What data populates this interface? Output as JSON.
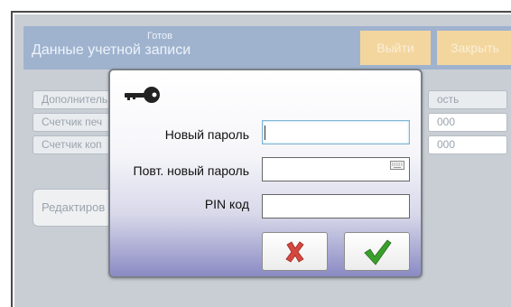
{
  "header": {
    "title": "Данные учетной записи",
    "status": "Готов",
    "logout_label": "Выйти",
    "close_label": "Закрыть"
  },
  "background_fields": [
    "Дополнитель",
    "Счетчик печ",
    "Счетчик коп"
  ],
  "background_values": [
    "ость",
    "000",
    "000"
  ],
  "edit_button": "Редактиров",
  "dialog": {
    "new_password_label": "Новый пароль",
    "new_password_value": "",
    "repeat_password_label": "Повт. новый пароль",
    "repeat_password_value": "",
    "pin_label": "PIN код",
    "pin_value": "",
    "cancel_icon": "red-x-icon",
    "ok_icon": "green-check-icon"
  },
  "colors": {
    "header_bg": "#9fb3cf",
    "header_button_bg": "#f3d69e",
    "cancel": "#d6473f",
    "ok": "#3aa02c"
  }
}
